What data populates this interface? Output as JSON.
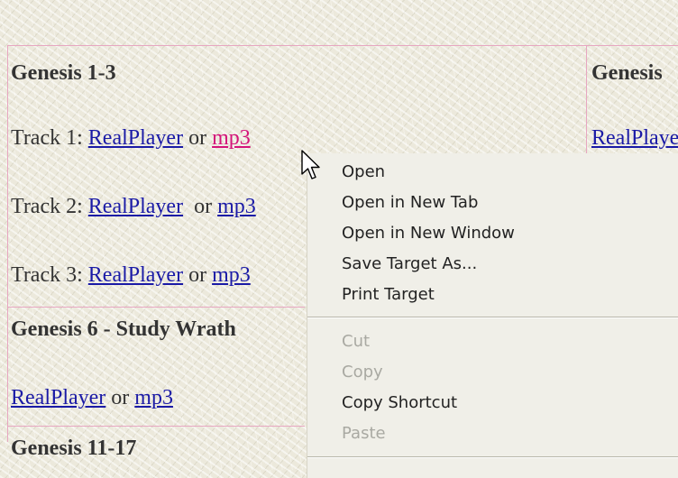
{
  "sections": {
    "genesis_1_3": {
      "title": "Genesis 1-3",
      "tracks": [
        {
          "label": "Track 1: ",
          "realplayer": "RealPlayer",
          "or": " or ",
          "mp3": "mp3"
        },
        {
          "label": "Track 2: ",
          "realplayer": "RealPlayer",
          "or": "  or ",
          "mp3": "mp3"
        },
        {
          "label": "Track 3: ",
          "realplayer": "RealPlayer",
          "or": " or ",
          "mp3": "mp3"
        }
      ]
    },
    "genesis_right": {
      "title": "Genesis",
      "realplayer": "RealPlayer"
    },
    "genesis_6": {
      "title": "Genesis 6 - Study Wrath",
      "realplayer": "RealPlayer",
      "or": " or ",
      "mp3": "mp3"
    },
    "genesis_11_17": {
      "title": "Genesis 11-17"
    }
  },
  "context_menu": {
    "items": [
      {
        "label": "Open",
        "enabled": true
      },
      {
        "label": "Open in New Tab",
        "enabled": true
      },
      {
        "label": "Open in New Window",
        "enabled": true
      },
      {
        "label": "Save Target As...",
        "enabled": true
      },
      {
        "label": "Print Target",
        "enabled": true
      },
      {
        "label": "Cut",
        "enabled": false
      },
      {
        "label": "Copy",
        "enabled": false
      },
      {
        "label": "Copy Shortcut",
        "enabled": true
      },
      {
        "label": "Paste",
        "enabled": false
      }
    ]
  },
  "colors": {
    "background": "#ece9dc",
    "border": "#e7a7c1",
    "link": "#1a1aa6",
    "link_hover": "#d4147a",
    "menu_background": "#f0efe8",
    "menu_disabled": "#a9a9a2"
  },
  "cursor": "arrow-pointer-icon"
}
